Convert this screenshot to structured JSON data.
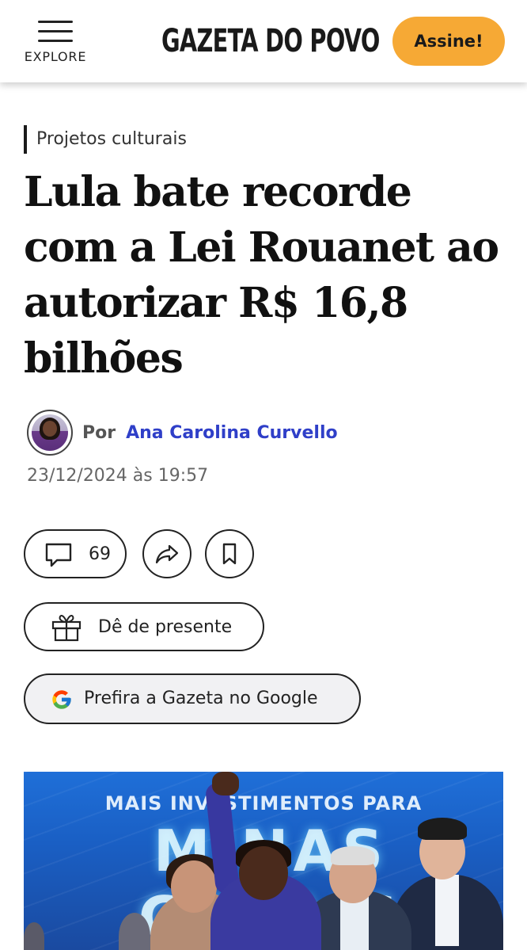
{
  "header": {
    "menu_label": "EXPLORE",
    "logo_text": "GAZETA DO POVO",
    "subscribe_label": "Assine!",
    "subscribe_color": "#f6a935"
  },
  "article": {
    "section": "Projetos culturais",
    "headline": "Lula bate recorde com a Lei Rouanet ao autorizar R$ 16,8 bilhões",
    "byline_prefix": "Por",
    "author": "Ana Carolina Curvello",
    "author_color": "#2f3fc8",
    "timestamp": "23/12/2024 às 19:57"
  },
  "actions": {
    "comments_icon": "comment-icon",
    "comments_count": "69",
    "share_icon": "share-icon",
    "bookmark_icon": "bookmark-icon",
    "gift_icon": "gift-icon",
    "gift_label": "Dê de presente",
    "google_icon": "google-icon",
    "google_label": "Prefira a Gazeta no Google"
  },
  "hero_image": {
    "banner_top": "MAIS INVESTIMENTOS PARA",
    "banner_big": "MINAS GERAIS"
  }
}
